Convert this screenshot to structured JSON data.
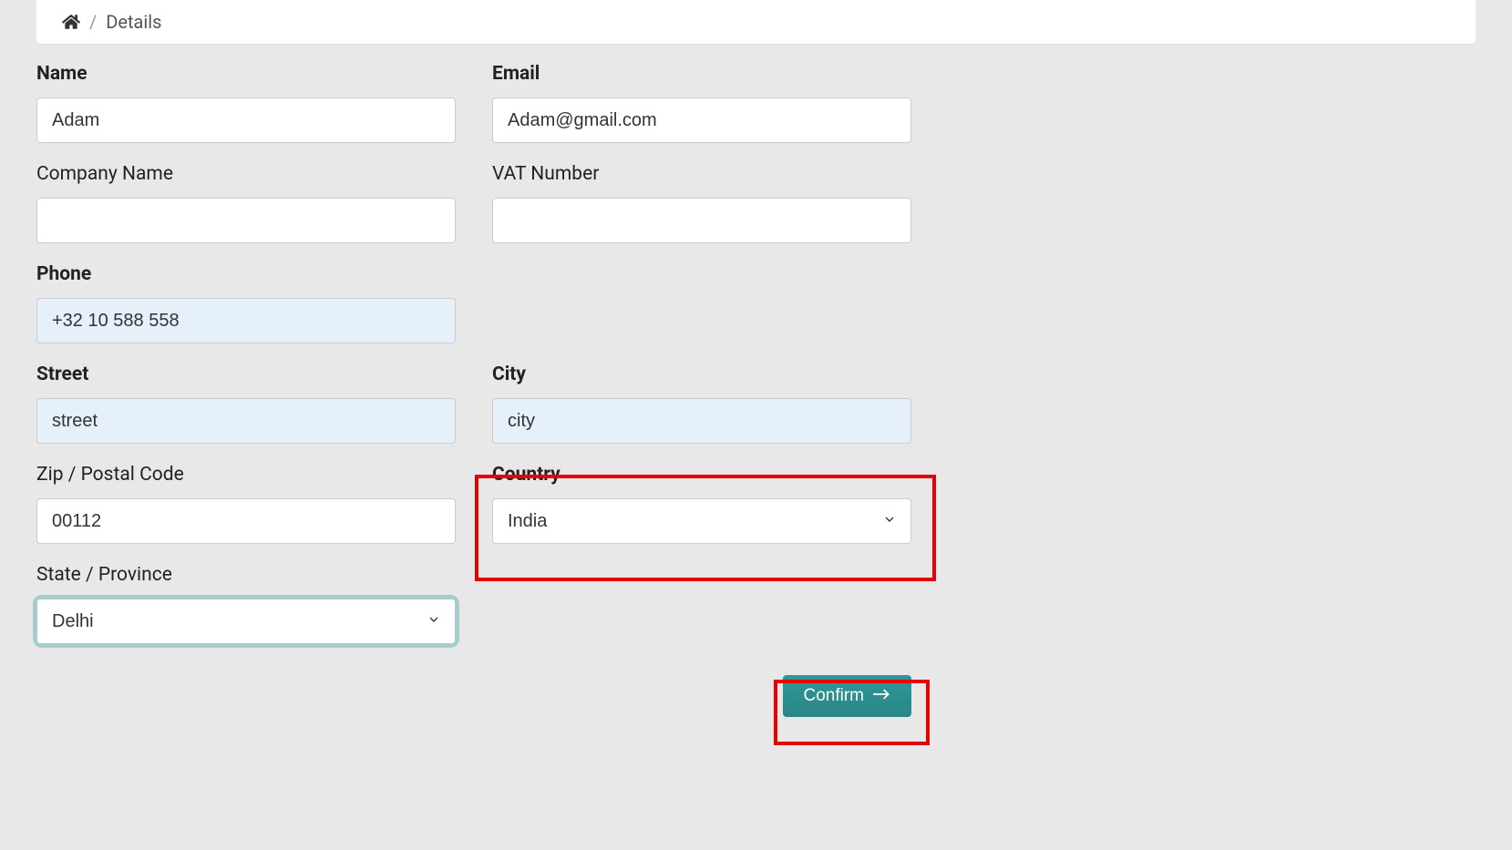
{
  "breadcrumb": {
    "separator": "/",
    "current": "Details"
  },
  "form": {
    "name": {
      "label": "Name",
      "value": "Adam"
    },
    "email": {
      "label": "Email",
      "value": "Adam@gmail.com"
    },
    "company_name": {
      "label": "Company Name",
      "value": ""
    },
    "vat_number": {
      "label": "VAT Number",
      "value": ""
    },
    "phone": {
      "label": "Phone",
      "value": "+32 10 588 558"
    },
    "street": {
      "label": "Street",
      "value": "street"
    },
    "city": {
      "label": "City",
      "value": "city"
    },
    "zip": {
      "label": "Zip / Postal Code",
      "value": "00112"
    },
    "country": {
      "label": "Country",
      "selected": "India"
    },
    "state": {
      "label": "State / Province",
      "selected": "Delhi"
    }
  },
  "buttons": {
    "confirm": "Confirm"
  }
}
